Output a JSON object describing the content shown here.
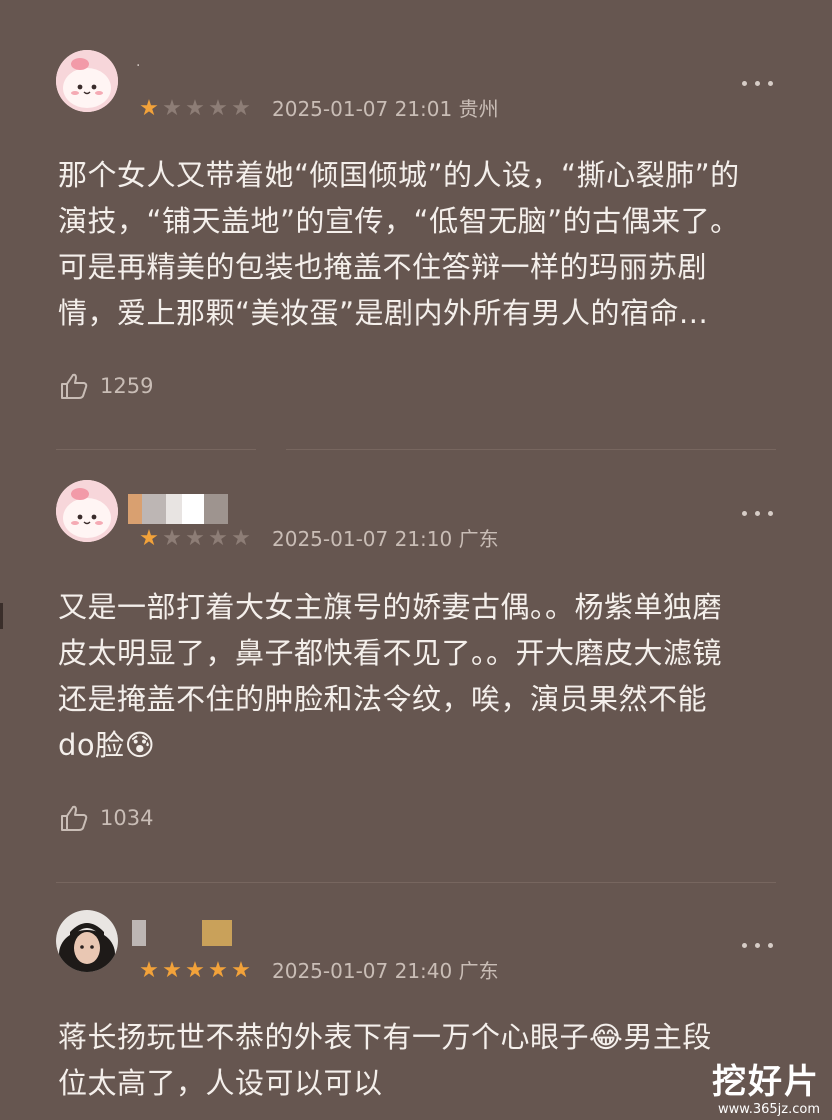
{
  "reviews": [
    {
      "username": "·",
      "rating": 1,
      "max_rating": 5,
      "date": "2025-01-07 21:01",
      "location": "贵州",
      "text_lines": [
        "那个女人又带着她“倾国倾城”的人设，“撕心裂肺”的",
        "演技，“铺天盖地”的宣传，“低智无脑”的古偶来了。",
        "可是再精美的包装也掩盖不住答辩一样的玛丽苏剧",
        "情，爱上那颗“美妆蛋”是剧内外所有男人的宿命..."
      ],
      "likes": "1259"
    },
    {
      "username": "",
      "rating": 1,
      "max_rating": 5,
      "date": "2025-01-07 21:10",
      "location": "广东",
      "text_lines": [
        "又是一部打着大女主旗号的娇妻古偶。。杨紫单独磨",
        "皮太明显了，鼻子都快看不见了。。开大磨皮大滤镜",
        "还是掩盖不住的肿脸和法令纹，唉，演员果然不能",
        "do脸😰"
      ],
      "likes": "1034"
    },
    {
      "username": "",
      "rating": 5,
      "max_rating": 5,
      "date": "2025-01-07 21:40",
      "location": "广东",
      "text_lines": [
        "蒋长扬玩世不恭的外表下有一万个心眼子😂男主段",
        "位太高了，人设可以可以"
      ],
      "likes": ""
    }
  ],
  "watermark": {
    "title": "挖好片",
    "site": "www.365jz.com"
  },
  "colors": {
    "background": "#665650",
    "star_filled": "#f2a23a",
    "star_empty": "#8d7d76"
  }
}
